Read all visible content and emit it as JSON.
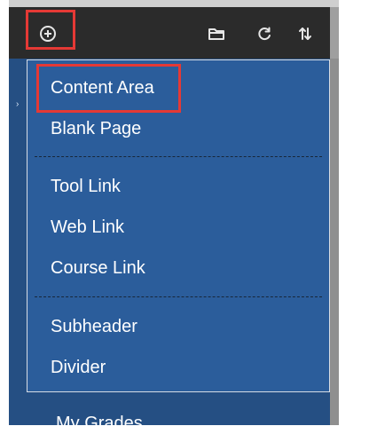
{
  "toolbar": {
    "icons": {
      "add": "plus-circle-icon",
      "folder": "folder-icon",
      "refresh": "refresh-icon",
      "sort": "sort-icon"
    },
    "colors": {
      "toolbar_bg": "#2b2b2b",
      "menu_bg": "#2b5d9b",
      "panel_bg": "#254f83",
      "highlight": "#e53935"
    }
  },
  "menu": {
    "items": [
      "Content Area",
      "Blank Page",
      "Tool Link",
      "Web Link",
      "Course Link",
      "Subheader",
      "Divider"
    ]
  },
  "background_nav": {
    "bottom_item": "My Grades"
  }
}
